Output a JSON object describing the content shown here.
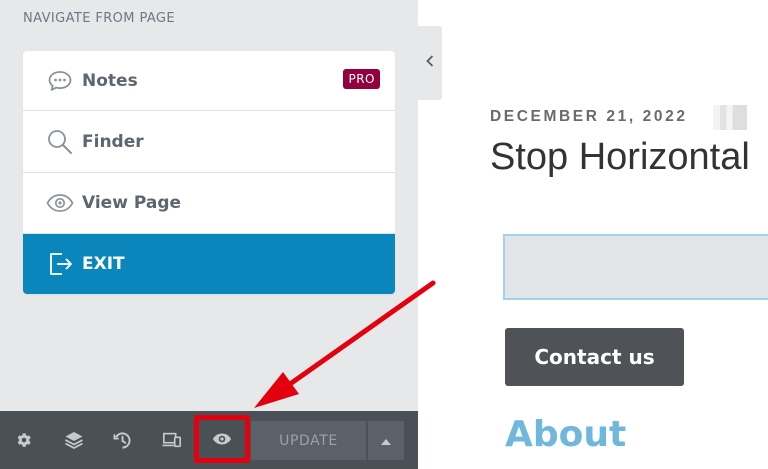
{
  "panel": {
    "section_title": "NAVIGATE FROM PAGE",
    "items": [
      {
        "label": "Notes",
        "icon": "chat-bubble-icon",
        "badge": "PRO"
      },
      {
        "label": "Finder",
        "icon": "search-icon"
      },
      {
        "label": "View Page",
        "icon": "eye-icon"
      },
      {
        "label": "EXIT",
        "icon": "exit-icon"
      }
    ]
  },
  "toolbar": {
    "buttons": [
      "settings-icon",
      "layers-icon",
      "history-icon",
      "responsive-icon",
      "preview-icon"
    ],
    "update_label": "UPDATE"
  },
  "page": {
    "date": "DECEMBER 21, 2022",
    "title": "Stop Horizontal",
    "contact_label": "Contact us",
    "about_heading": "About"
  },
  "colors": {
    "panel_bg": "#e6e8ea",
    "exit_bg": "#0b86bd",
    "pro_badge": "#93003f",
    "toolbar_bg": "#495157",
    "highlight": "#e3000f",
    "about": "#6fb7dd"
  }
}
